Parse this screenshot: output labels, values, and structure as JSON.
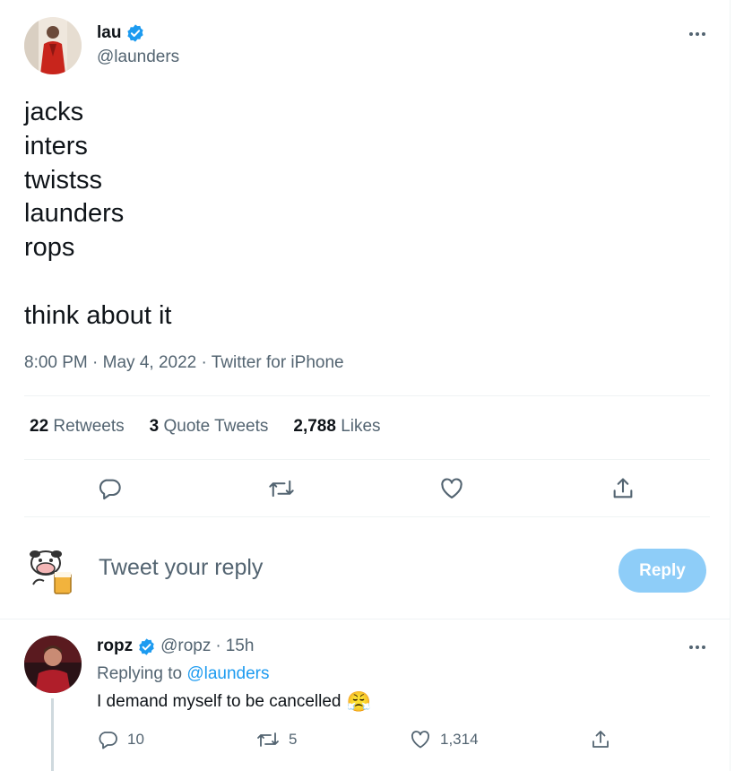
{
  "tweet": {
    "author_name": "lau",
    "author_handle": "@launders",
    "text": "jacks\ninters\ntwistss\nlaunders\nrops\n\nthink about it",
    "meta": "8:00 PM · May 4, 2022 · Twitter for iPhone",
    "stats": {
      "retweets_count": "22",
      "retweets_label": "Retweets",
      "quotes_count": "3",
      "quotes_label": "Quote Tweets",
      "likes_count": "2,788",
      "likes_label": "Likes"
    }
  },
  "composer": {
    "placeholder": "Tweet your reply",
    "button_label": "Reply"
  },
  "reply": {
    "author_name": "ropz",
    "author_handle": "@ropz",
    "separator": "·",
    "time": "15h",
    "replying_prefix": "Replying to",
    "replying_to": "@launders",
    "text": "I demand myself to be cancelled",
    "emoji": "😤",
    "reply_count": "10",
    "retweet_count": "5",
    "like_count": "1,314"
  },
  "colors": {
    "verified": "#1d9bf0",
    "link": "#1d9bf0",
    "reply_button": "#8ecdf8",
    "secondary_text": "#536471"
  },
  "icons": [
    "verified-badge-icon",
    "more-icon",
    "reply-icon",
    "retweet-icon",
    "like-icon",
    "share-icon"
  ]
}
